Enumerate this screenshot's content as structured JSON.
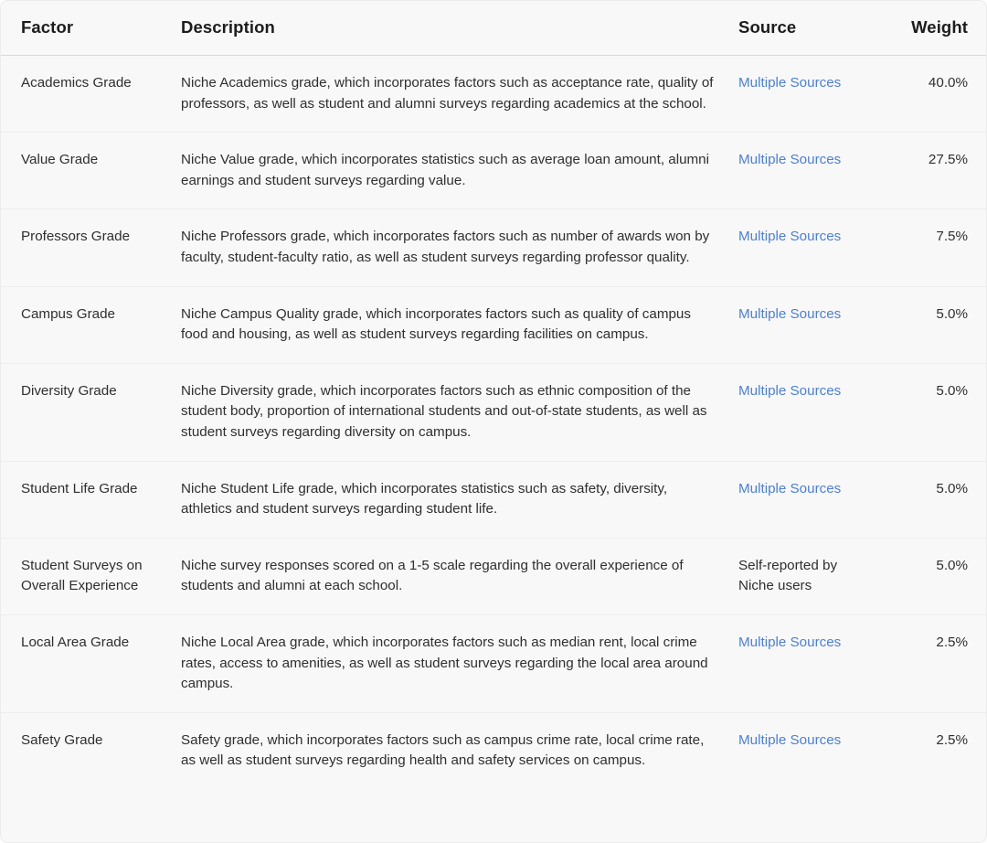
{
  "table": {
    "columns": [
      {
        "key": "factor",
        "label": "Factor"
      },
      {
        "key": "description",
        "label": "Description"
      },
      {
        "key": "source",
        "label": "Source"
      },
      {
        "key": "weight",
        "label": "Weight"
      }
    ],
    "link_color": "#4c7fd6",
    "text_color": "#2f2f2f",
    "header_color": "#1c1c1c",
    "background_color": "#f8f8f8",
    "divider_color": "#ededed",
    "header_divider_color": "#d9d9d9",
    "rows": [
      {
        "factor": "Academics Grade",
        "description": "Niche Academics grade, which incorporates factors such as acceptance rate, quality of professors, as well as student and alumni surveys regarding academics at the school.",
        "source": "Multiple Sources",
        "source_is_link": true,
        "weight": "40.0%"
      },
      {
        "factor": "Value Grade",
        "description": "Niche Value grade, which incorporates statistics such as average loan amount, alumni earnings and student surveys regarding value.",
        "source": "Multiple Sources",
        "source_is_link": true,
        "weight": "27.5%"
      },
      {
        "factor": "Professors Grade",
        "description": "Niche Professors grade, which incorporates factors such as number of awards won by faculty, student-faculty ratio, as well as student surveys regarding professor quality.",
        "source": "Multiple Sources",
        "source_is_link": true,
        "weight": "7.5%"
      },
      {
        "factor": "Campus Grade",
        "description": "Niche Campus Quality grade, which incorporates factors such as quality of campus food and housing, as well as student surveys regarding facilities on campus.",
        "source": "Multiple Sources",
        "source_is_link": true,
        "weight": "5.0%"
      },
      {
        "factor": "Diversity Grade",
        "description": "Niche Diversity grade, which incorporates factors such as ethnic composition of the student body, proportion of international students and out-of-state students, as well as student surveys regarding diversity on campus.",
        "source": "Multiple Sources",
        "source_is_link": true,
        "weight": "5.0%"
      },
      {
        "factor": "Student Life Grade",
        "description": "Niche Student Life grade, which incorporates statistics such as safety, diversity, athletics and student surveys regarding student life.",
        "source": "Multiple Sources",
        "source_is_link": true,
        "weight": "5.0%"
      },
      {
        "factor": "Student Surveys on Overall Experience",
        "description": "Niche survey responses scored on a 1-5 scale regarding the overall experience of students and alumni at each school.",
        "source": "Self-reported by Niche users",
        "source_is_link": false,
        "weight": "5.0%"
      },
      {
        "factor": "Local Area Grade",
        "description": "Niche Local Area grade, which incorporates factors such as median rent, local crime rates, access to amenities, as well as student surveys regarding the local area around campus.",
        "source": "Multiple Sources",
        "source_is_link": true,
        "weight": "2.5%"
      },
      {
        "factor": "Safety Grade",
        "description": "Safety grade, which incorporates factors such as campus crime rate, local crime rate, as well as student surveys regarding health and safety services on campus.",
        "source": "Multiple Sources",
        "source_is_link": true,
        "weight": "2.5%"
      }
    ]
  }
}
